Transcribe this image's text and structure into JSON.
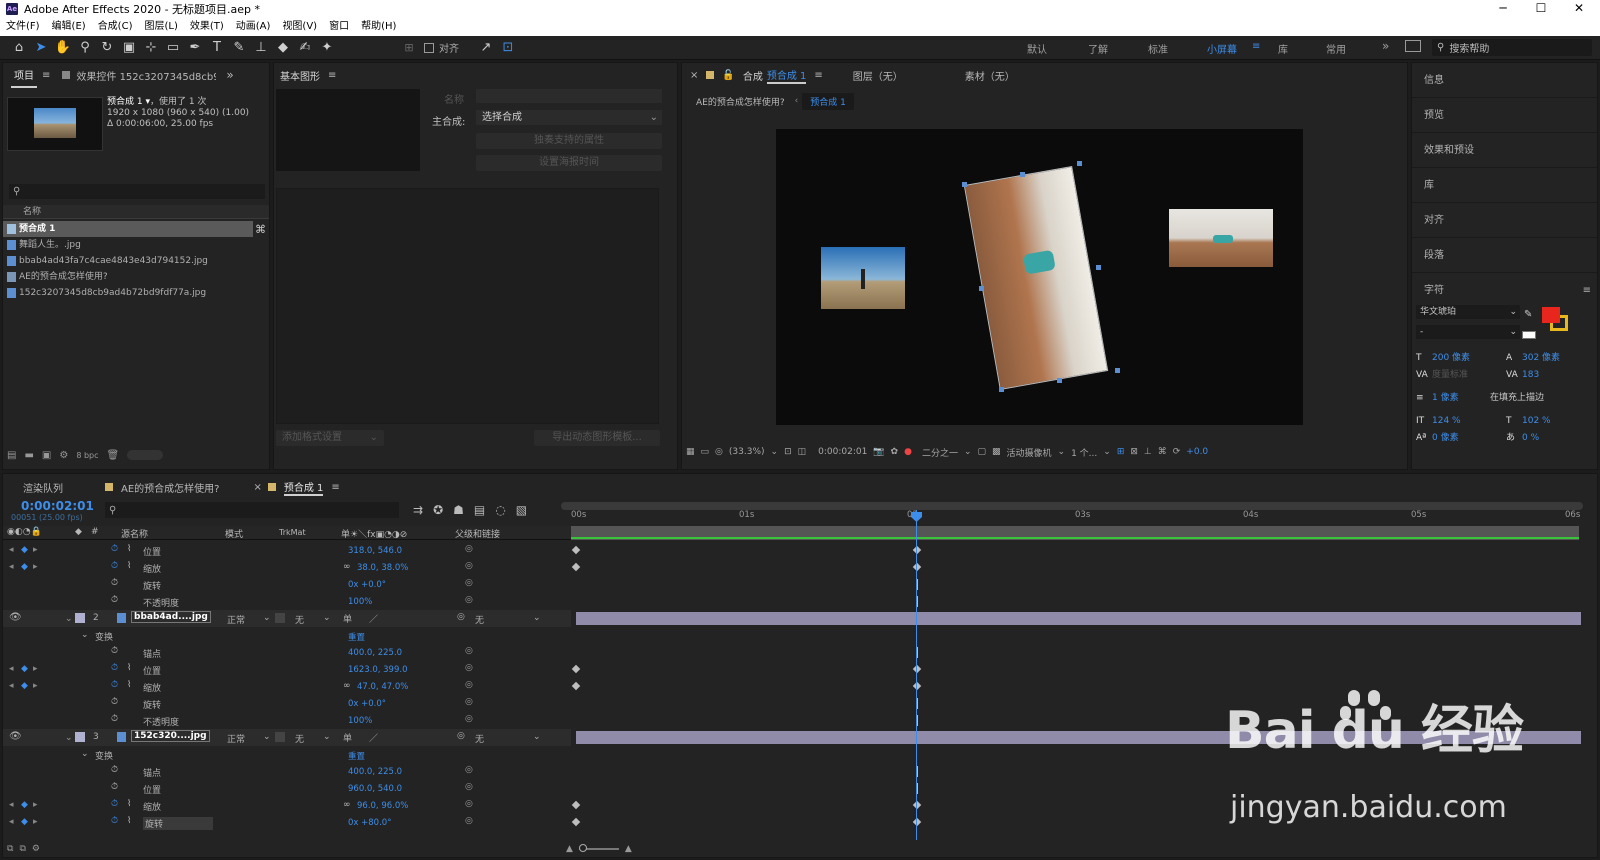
{
  "window": {
    "title": "Adobe After Effects 2020 - 无标题项目.aep *",
    "logo_text": "Ae"
  },
  "menu": [
    "文件(F)",
    "编辑(E)",
    "合成(C)",
    "图层(L)",
    "效果(T)",
    "动画(A)",
    "视图(V)",
    "窗口",
    "帮助(H)"
  ],
  "toolbar": {
    "align_label": "对齐",
    "workspaces": [
      "默认",
      "了解",
      "标准",
      "小屏幕",
      "库",
      "常用"
    ],
    "active_workspace": "小屏幕",
    "search_placeholder": "搜索帮助"
  },
  "project": {
    "tab_project": "项目",
    "tab_effects": "效果控件 152c3207345d8cb9ad4",
    "selected_name": "预合成 1 ▾",
    "usage": "，使用了 1 次",
    "dims": "1920 x 1080 (960 x 540) (1.00)",
    "duration": "Δ 0:00:06:00, 25.00 fps",
    "search_placeholder": "",
    "col_name": "名称",
    "items": [
      {
        "name": "预合成 1",
        "selected": true
      },
      {
        "name": "舞蹈人生。.jpg",
        "selected": false
      },
      {
        "name": "bbab4ad43fa7c4cae4843e43d794152.jpg",
        "selected": false
      },
      {
        "name": "AE的预合成怎样使用?",
        "selected": false
      },
      {
        "name": "152c3207345d8cb9ad4b72bd9fdf77a.jpg",
        "selected": false
      }
    ],
    "bpc": "8 bpc"
  },
  "essential_graphics": {
    "title": "基本图形",
    "name_label": "名称",
    "master_label": "主合成:",
    "master_value": "选择合成",
    "btn_solo": "独奏支持的属性",
    "btn_poster": "设置海报时间",
    "btn_add_format": "添加格式设置",
    "btn_export": "导出动态图形模板..."
  },
  "composition": {
    "tab_comp_prefix": "合成",
    "tab_comp_name": "预合成 1",
    "tab_layer": "图层（无）",
    "tab_footage": "素材（无）",
    "breadcrumb_parent": "AE的预合成怎样使用?",
    "breadcrumb_current": "预合成 1",
    "zoom": "(33.3%)",
    "timecode": "0:00:02:01",
    "resolution": "二分之一",
    "camera": "活动摄像机",
    "views": "1 个...",
    "exposure": "+0.0"
  },
  "right_panels": {
    "items": [
      "信息",
      "预览",
      "效果和预设",
      "库",
      "对齐",
      "段落"
    ],
    "character_title": "字符",
    "font_family": "华文琥珀",
    "font_style": "-",
    "font_size": "200 像素",
    "leading": "302 像素",
    "kerning": "度量标准",
    "tracking": "183",
    "stroke_width": "1 像素",
    "stroke_mode": "在填充上描边",
    "vscale": "124 %",
    "hscale": "102 %",
    "baseline": "0 像素",
    "tsume": "0 %",
    "fill_color": "#e8261d",
    "stroke_color": "#e6b81d"
  },
  "timeline": {
    "tab_render": "渲染队列",
    "tab_comp1": "AE的预合成怎样使用?",
    "tab_comp2": "预合成 1",
    "timecode": "0:00:02:01",
    "frame_info": "00051 (25.00 fps)",
    "col_source": "源名称",
    "col_mode": "模式",
    "col_trkmat": "TrkMat",
    "col_parent": "父级和链接",
    "ruler": [
      "00s",
      "01s",
      "02s",
      "03s",
      "04s",
      "05s",
      "06s"
    ],
    "rows": [
      {
        "type": "prop",
        "name": "位置",
        "value": "318.0, 546.0",
        "kf": true,
        "graph": true
      },
      {
        "type": "prop",
        "name": "缩放",
        "value": "38.0, 38.0%",
        "kf": true,
        "graph": true,
        "link": true
      },
      {
        "type": "prop",
        "name": "旋转",
        "value": "0x +0.0°"
      },
      {
        "type": "prop",
        "name": "不透明度",
        "value": "100%"
      },
      {
        "type": "layer",
        "num": "2",
        "name": "bbab4ad....jpg",
        "mode": "正常",
        "trk": "无",
        "parent": "无"
      },
      {
        "type": "group",
        "name": "变换",
        "value": "重置"
      },
      {
        "type": "prop",
        "name": "锚点",
        "value": "400.0, 225.0"
      },
      {
        "type": "prop",
        "name": "位置",
        "value": "1623.0, 399.0",
        "kf": true,
        "graph": true
      },
      {
        "type": "prop",
        "name": "缩放",
        "value": "47.0, 47.0%",
        "kf": true,
        "graph": true,
        "link": true
      },
      {
        "type": "prop",
        "name": "旋转",
        "value": "0x +0.0°"
      },
      {
        "type": "prop",
        "name": "不透明度",
        "value": "100%"
      },
      {
        "type": "layer",
        "num": "3",
        "name": "152c320....jpg",
        "mode": "正常",
        "trk": "无",
        "parent": "无"
      },
      {
        "type": "group",
        "name": "变换",
        "value": "重置"
      },
      {
        "type": "prop",
        "name": "锚点",
        "value": "400.0, 225.0"
      },
      {
        "type": "prop",
        "name": "位置",
        "value": "960.0, 540.0"
      },
      {
        "type": "prop",
        "name": "缩放",
        "value": "96.0, 96.0%",
        "kf": true,
        "graph": true,
        "link": true
      },
      {
        "type": "prop",
        "name": "旋转",
        "value": "0x +80.0°",
        "kf": true,
        "graph": true
      }
    ]
  },
  "watermark": {
    "brand": "Bai du 经验",
    "url": "jingyan.baidu.com"
  }
}
